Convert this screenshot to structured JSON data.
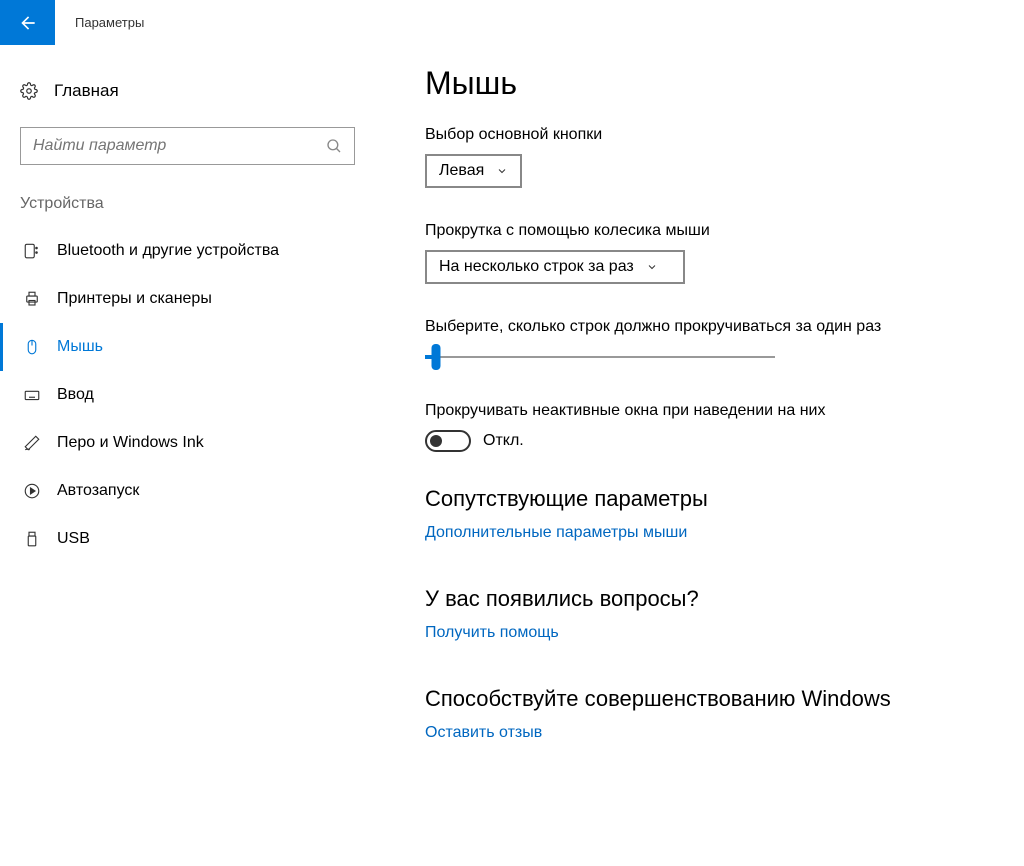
{
  "header": {
    "title": "Параметры"
  },
  "sidebar": {
    "home": "Главная",
    "search_placeholder": "Найти параметр",
    "category": "Устройства",
    "items": [
      {
        "label": "Bluetooth и другие устройства"
      },
      {
        "label": "Принтеры и сканеры"
      },
      {
        "label": "Мышь"
      },
      {
        "label": "Ввод"
      },
      {
        "label": "Перо и Windows Ink"
      },
      {
        "label": "Автозапуск"
      },
      {
        "label": "USB"
      }
    ]
  },
  "main": {
    "title": "Мышь",
    "primary_button_label": "Выбор основной кнопки",
    "primary_button_value": "Левая",
    "scroll_mode_label": "Прокрутка с помощью колесика мыши",
    "scroll_mode_value": "На несколько строк за раз",
    "lines_label": "Выберите, сколько строк должно прокручиваться за один раз",
    "inactive_scroll_label": "Прокручивать неактивные окна при наведении на них",
    "inactive_scroll_value": "Откл.",
    "related_title": "Сопутствующие параметры",
    "related_link": "Дополнительные параметры мыши",
    "questions_title": "У вас появились вопросы?",
    "questions_link": "Получить помощь",
    "feedback_title": "Способствуйте совершенствованию Windows",
    "feedback_link": "Оставить отзыв"
  }
}
